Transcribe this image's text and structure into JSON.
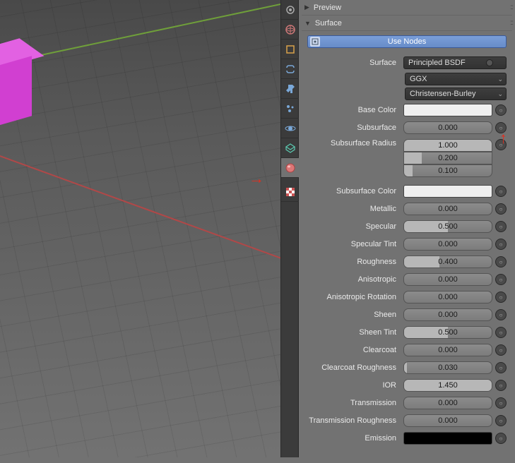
{
  "panels": {
    "preview": "Preview",
    "surface": "Surface"
  },
  "use_nodes_label": "Use Nodes",
  "surface_shader": {
    "label": "Surface",
    "value": "Principled BSDF"
  },
  "distribution": "GGX",
  "sss_method": "Christensen-Burley",
  "props": {
    "base_color": {
      "label": "Base Color"
    },
    "subsurface": {
      "label": "Subsurface",
      "value": "0.000",
      "fill": 0
    },
    "subsurface_radius": {
      "label": "Subsurface Radius",
      "values": [
        "1.000",
        "0.200",
        "0.100"
      ]
    },
    "subsurface_color": {
      "label": "Subsurface Color"
    },
    "metallic": {
      "label": "Metallic",
      "value": "0.000",
      "fill": 0
    },
    "specular": {
      "label": "Specular",
      "value": "0.500",
      "fill": 50
    },
    "specular_tint": {
      "label": "Specular Tint",
      "value": "0.000",
      "fill": 0
    },
    "roughness": {
      "label": "Roughness",
      "value": "0.400",
      "fill": 40
    },
    "anisotropic": {
      "label": "Anisotropic",
      "value": "0.000",
      "fill": 0
    },
    "anisotropic_rotation": {
      "label": "Anisotropic Rotation",
      "value": "0.000",
      "fill": 0
    },
    "sheen": {
      "label": "Sheen",
      "value": "0.000",
      "fill": 0
    },
    "sheen_tint": {
      "label": "Sheen Tint",
      "value": "0.500",
      "fill": 50
    },
    "clearcoat": {
      "label": "Clearcoat",
      "value": "0.000",
      "fill": 0
    },
    "clearcoat_roughness": {
      "label": "Clearcoat Roughness",
      "value": "0.030",
      "fill": 3
    },
    "ior": {
      "label": "IOR",
      "value": "1.450",
      "fill": 100
    },
    "transmission": {
      "label": "Transmission",
      "value": "0.000",
      "fill": 0
    },
    "transmission_roughness": {
      "label": "Transmission Roughness",
      "value": "0.000",
      "fill": 0
    },
    "emission": {
      "label": "Emission"
    }
  },
  "tab_icons": [
    "render-icon",
    "world-icon",
    "object-icon",
    "constraints-icon",
    "modifiers-icon",
    "particles-icon",
    "physics-icon",
    "data-icon",
    "material-icon",
    "texture-icon"
  ],
  "active_tab": 8,
  "annotation_arrows": {
    "viewport_arrow": "→",
    "basecolor_arrow": "↑"
  }
}
